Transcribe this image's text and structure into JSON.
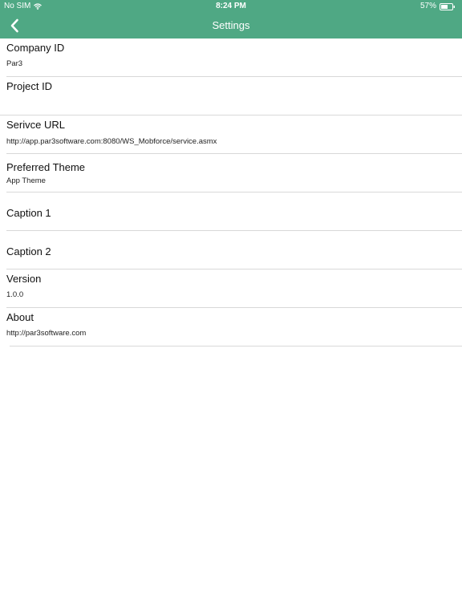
{
  "status_bar": {
    "carrier": "No SIM",
    "time": "8:24 PM",
    "battery": "57%"
  },
  "nav": {
    "title": "Settings"
  },
  "rows": [
    {
      "label": "Company ID",
      "value": "Par3"
    },
    {
      "label": "Project ID",
      "value": ""
    },
    {
      "label": "Serivce URL",
      "value": "http://app.par3software.com:8080/WS_Mobforce/service.asmx"
    },
    {
      "label": "Preferred Theme",
      "value": "App Theme"
    },
    {
      "label": "Caption 1",
      "value": ""
    },
    {
      "label": "Caption 2",
      "value": ""
    },
    {
      "label": "Version",
      "value": "1.0.0"
    },
    {
      "label": "About",
      "value": "http://par3software.com"
    }
  ],
  "colors": {
    "header": "#4fa884"
  }
}
